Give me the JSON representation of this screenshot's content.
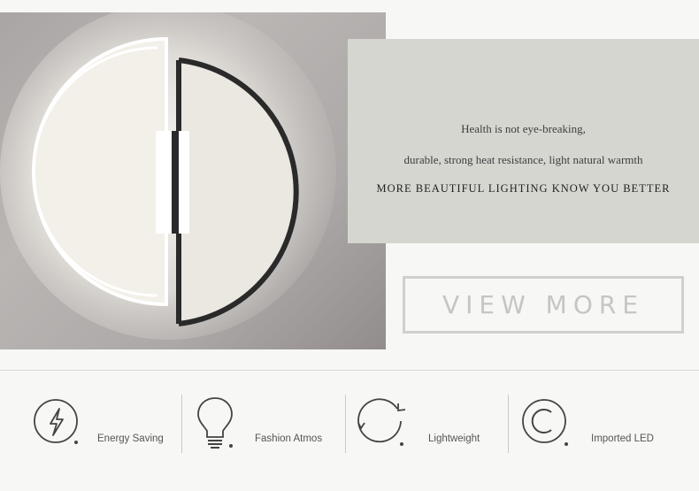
{
  "info": {
    "line1": "Health is not eye-breaking,",
    "line2": "durable, strong heat resistance, light natural warmth",
    "line3": "MORE BEAUTIFUL LIGHTING KNOW YOU BETTER"
  },
  "view_more_label": "VIEW  MORE",
  "features": [
    {
      "icon": "lightning-icon",
      "label": "Energy Saving"
    },
    {
      "icon": "lightbulb-icon",
      "label": "Fashion Atmos"
    },
    {
      "icon": "refresh-icon",
      "label": "Lightweight"
    },
    {
      "icon": "copyright-icon",
      "label": "Imported LED"
    }
  ]
}
